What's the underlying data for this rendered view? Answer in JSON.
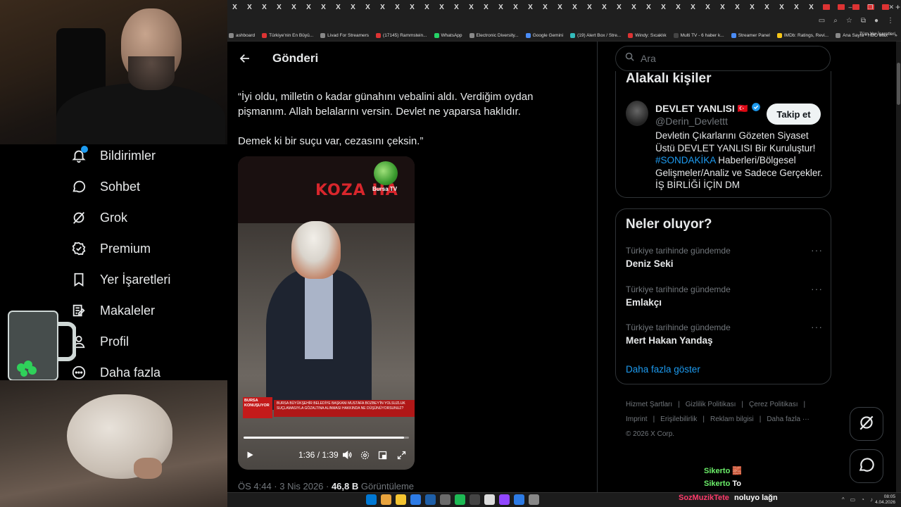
{
  "browser": {
    "tab_close_glyph": "X",
    "new_tab_glyph": "+",
    "bookmarks": [
      "ashboard",
      "Türkiye'nin En Büyü...",
      "Livad For Streamers",
      "(17145) Rammstein...",
      "WhatsApp",
      "Electronic Diversity...",
      "Google Gemini",
      "(19) Alert Box / Stre...",
      "Windy: Sıcaklık",
      "Multi TV - 6 haber k...",
      "Streamer Panel",
      "IMDb: Ratings, Revi...",
      "Ana Sayfa • HBO Max"
    ],
    "bookmarks_overflow": "»",
    "all_bookmarks": "Tüm Yer İşaretleri"
  },
  "sidebar": {
    "items": [
      {
        "label": "Bildirimler",
        "icon": "bell-icon"
      },
      {
        "label": "Sohbet",
        "icon": "chat-icon"
      },
      {
        "label": "Grok",
        "icon": "grok-icon"
      },
      {
        "label": "Premium",
        "icon": "verified-icon"
      },
      {
        "label": "Yer İşaretleri",
        "icon": "bookmark-icon"
      },
      {
        "label": "Makaleler",
        "icon": "article-icon"
      },
      {
        "label": "Profil",
        "icon": "profile-icon"
      },
      {
        "label": "Daha fazla",
        "icon": "more-icon"
      }
    ]
  },
  "post": {
    "header_title": "Gönderi",
    "paragraph_1": "“İyi oldu, milletin o kadar günahını vebalini aldı. Verdiğim oydan pişmanım. Allah belalarını versin. Devlet ne yaparsa haklıdır.",
    "paragraph_2": "Demek ki bir suçu var, cezasını çeksin.”",
    "video": {
      "shop_sign": "KOZA HA",
      "channel_logo": "Bursa TV",
      "lower_third_tag": "BURSA KONUŞUYOR",
      "lower_third_text": "BURSA BÜYÜKŞEHİR BELEDİYE BAŞKANI MUSTAFA BOZBEY'İN YOLSUZLUK SUÇLAMASIYLA GÖZALTINA ALINMASI HAKKINDA NE DÜŞÜNÜYORSUNUZ?",
      "time": "1:36 / 1:39",
      "progress": 0.97
    },
    "meta_time": "ÖS 4:44 · 3 Nis 2026 · ",
    "meta_views": "46,8 B",
    "meta_views_label": " Görüntüleme"
  },
  "right": {
    "search_placeholder": "Ara",
    "related_title": "Alakalı kişiler",
    "person": {
      "name": "DEVLET YANLISI",
      "flag": "🇹🇷",
      "handle": "@Derin_Devlettt",
      "follow_label": "Takip et",
      "bio_1": "Devletin Çıkarlarını Gözeten Siyaset Üstü DEVLET YANLISI Bir Kuruluştur!",
      "bio_hashtag": "#SONDAKİKA",
      "bio_2": " Haberleri/Bölgesel Gelişmeler/Analiz ve Sadece Gerçekler. İŞ BİRLİĞİ İÇİN DM"
    },
    "trends_title": "Neler oluyor?",
    "trends": [
      {
        "context": "Türkiye tarihinde gündemde",
        "name": "Deniz Seki"
      },
      {
        "context": "Türkiye tarihinde gündemde",
        "name": "Emlakçı"
      },
      {
        "context": "Türkiye tarihinde gündemde",
        "name": "Mert Hakan Yandaş"
      }
    ],
    "trend_more_glyph": "···",
    "show_more": "Daha fazla göster",
    "footer": [
      "Hizmet Şartları",
      "|",
      "Gizlilik Politikası",
      "|",
      "Çerez Politikası",
      "|",
      "Imprint",
      "|",
      "Erişilebilirlik",
      "|",
      "Reklam bilgisi",
      "|",
      "Daha fazla ···",
      "© 2026 X Corp."
    ]
  },
  "chat_overlay": [
    {
      "user": "Sikerto",
      "message": "🧱"
    },
    {
      "user": "Sikerto",
      "message": "To"
    },
    {
      "user": "SozMuzikTete",
      "message": "noluyo lağn"
    }
  ],
  "taskbar": {
    "time": "08:05",
    "date": "4.04.2026"
  },
  "colors": {
    "accent": "#1d9bf0",
    "background": "#000000",
    "text": "#e7e9ea",
    "muted": "#71767b"
  }
}
